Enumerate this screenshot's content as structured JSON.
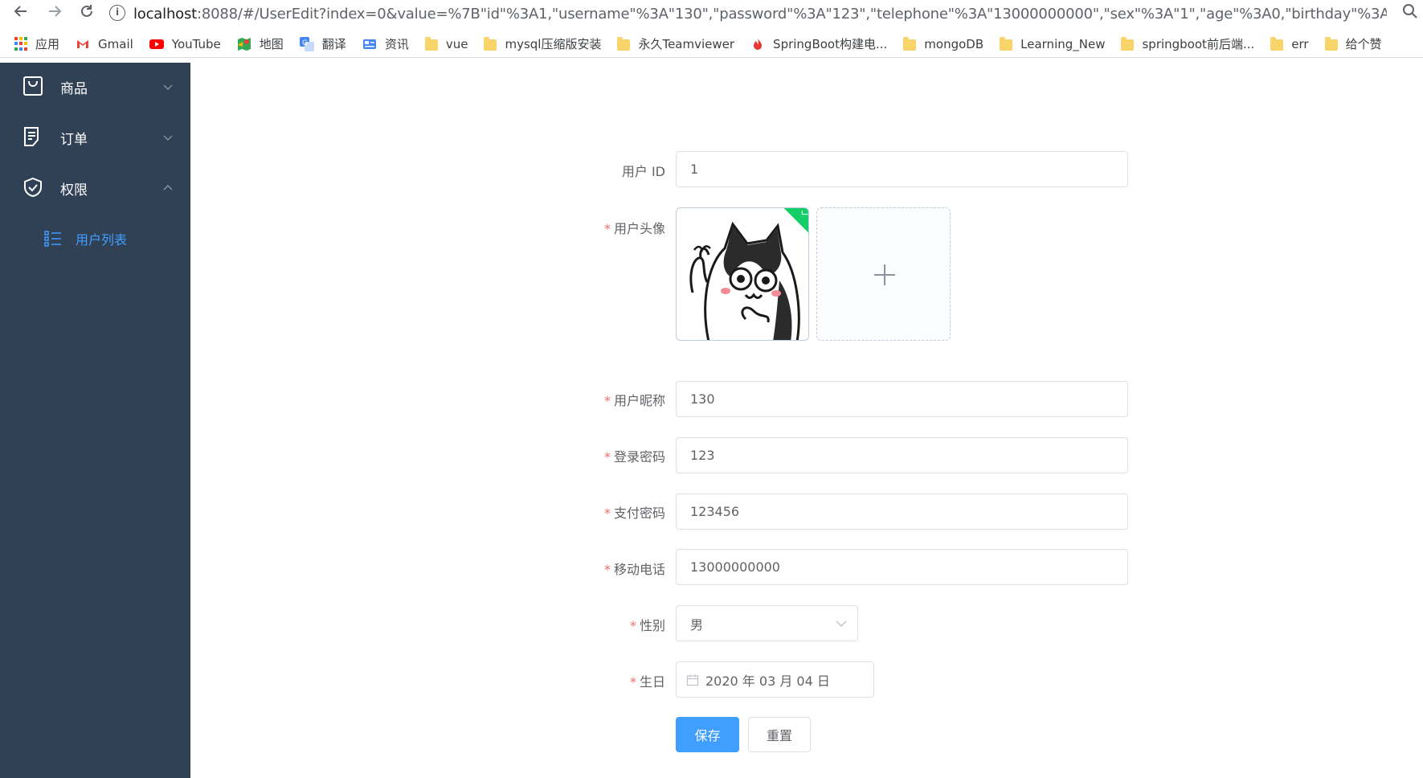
{
  "browser": {
    "url_host": "localhost",
    "url_rest": ":8088/#/UserEdit?index=0&value=%7B\"id\"%3A1,\"username\"%3A\"130\",\"password\"%3A\"123\",\"telephone\"%3A\"13000000000\",\"sex\"%3A\"1\",\"age\"%3A0,\"birthday\"%3A\"2020年0...",
    "bookmarks": [
      "应用",
      "Gmail",
      "YouTube",
      "地图",
      "翻译",
      "资讯",
      "vue",
      "mysql压缩版安装",
      "永久Teamviewer",
      "SpringBoot构建电...",
      "mongoDB",
      "Learning_New",
      "springboot前后端...",
      "err",
      "给个赞"
    ]
  },
  "sidebar": {
    "items": [
      {
        "label": "商品",
        "icon": "shopping-bag-icon",
        "expanded": false
      },
      {
        "label": "订单",
        "icon": "document-icon",
        "expanded": false
      },
      {
        "label": "权限",
        "icon": "shield-icon",
        "expanded": true
      }
    ],
    "sub_item": {
      "label": "用户列表",
      "icon": "list-icon"
    }
  },
  "form": {
    "user_id": {
      "label": "用户 ID",
      "value": "1"
    },
    "avatar": {
      "label": "用户头像"
    },
    "nickname": {
      "label": "用户昵称",
      "value": "130"
    },
    "login_password": {
      "label": "登录密码",
      "value": "123"
    },
    "pay_password": {
      "label": "支付密码",
      "value": "123456"
    },
    "mobile": {
      "label": "移动电话",
      "value": "13000000000"
    },
    "gender": {
      "label": "性别",
      "value": "男"
    },
    "birthday": {
      "label": "生日",
      "value": "2020 年 03 月 04 日"
    },
    "save_button": "保存",
    "reset_button": "重置"
  },
  "colors": {
    "sidebar_bg": "#304156",
    "accent": "#409eff",
    "required": "#f56c6c",
    "success": "#13ce66"
  }
}
